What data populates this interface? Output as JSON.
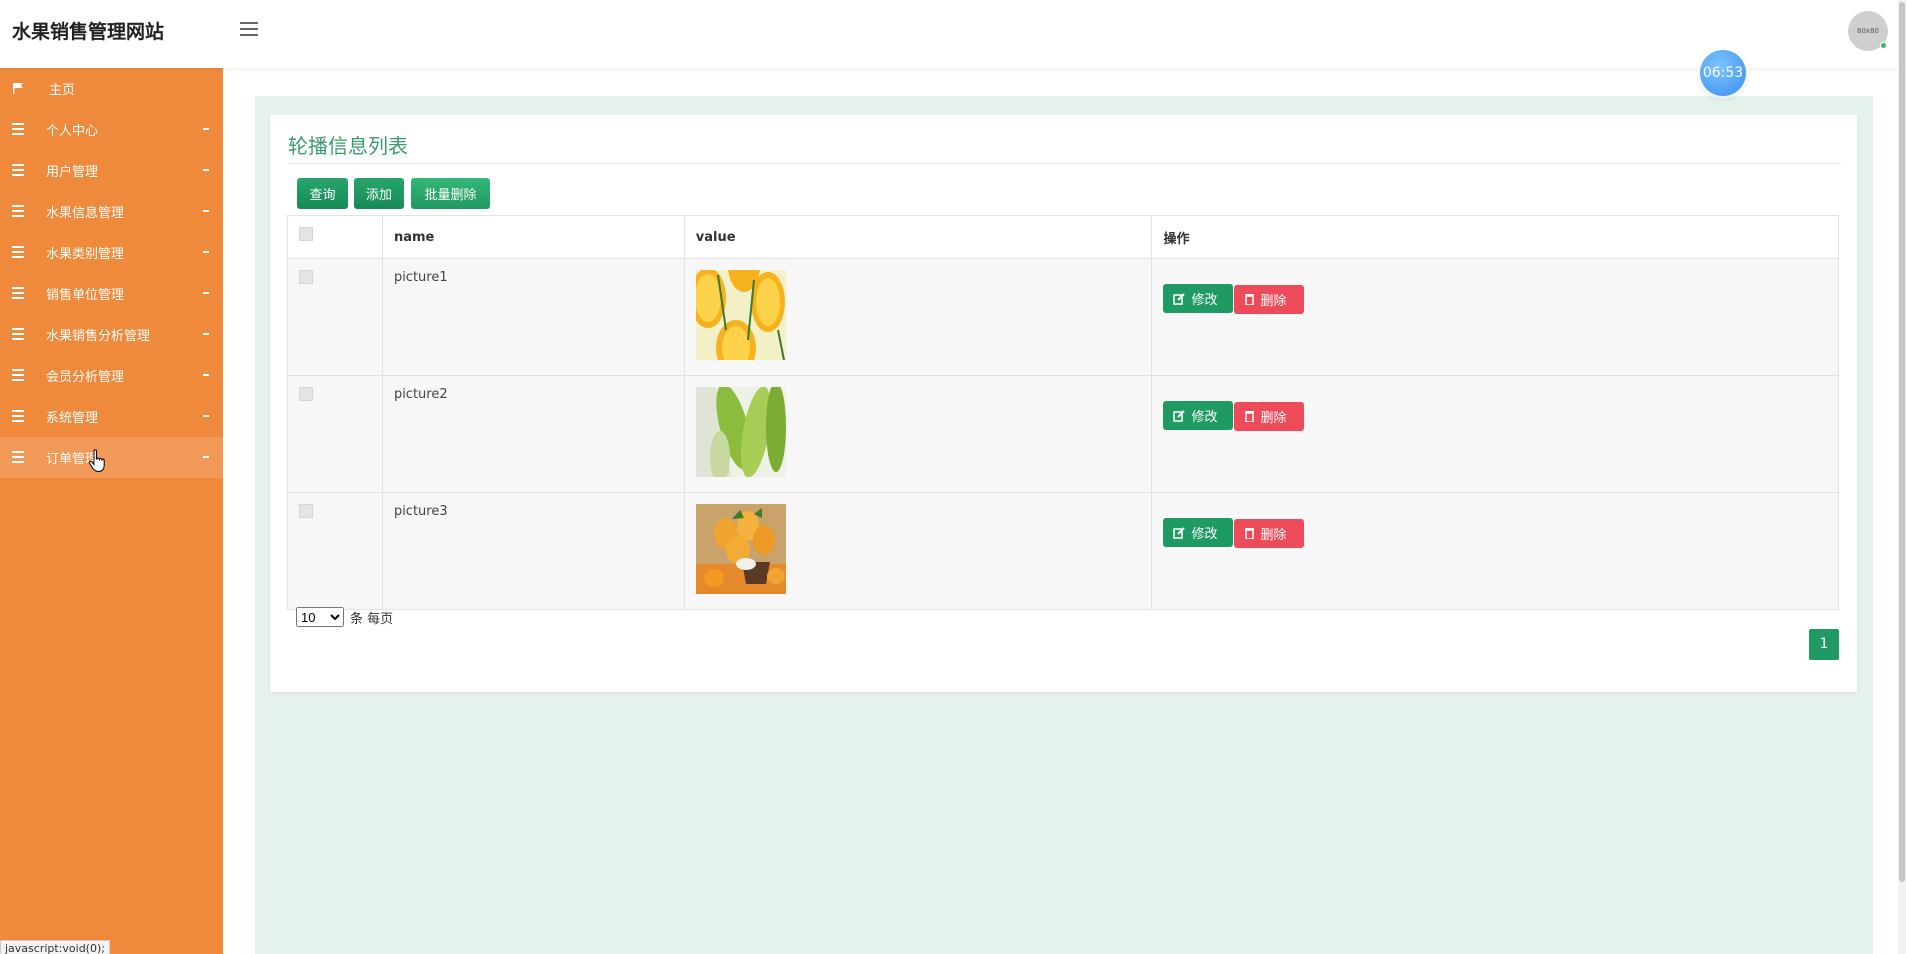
{
  "header": {
    "brand": "水果销售管理网站",
    "avatar_text": "80x80",
    "clock": "06:53"
  },
  "sidebar": {
    "items": [
      {
        "label": "主页",
        "icon": "flag-icon"
      },
      {
        "label": "个人中心",
        "icon": "menu-icon"
      },
      {
        "label": "用户管理",
        "icon": "menu-icon"
      },
      {
        "label": "水果信息管理",
        "icon": "menu-icon"
      },
      {
        "label": "水果类别管理",
        "icon": "menu-icon"
      },
      {
        "label": "销售单位管理",
        "icon": "menu-icon"
      },
      {
        "label": "水果销售分析管理",
        "icon": "menu-icon"
      },
      {
        "label": "会员分析管理",
        "icon": "menu-icon"
      },
      {
        "label": "系统管理",
        "icon": "menu-icon"
      },
      {
        "label": "订单管理",
        "icon": "menu-icon"
      }
    ]
  },
  "status_url": "javascript:void(0);",
  "panel": {
    "title": "轮播信息列表",
    "buttons": {
      "query": "查询",
      "add": "添加",
      "batch_delete": "批量删除"
    },
    "table": {
      "headers": {
        "name": "name",
        "value": "value",
        "ops": "操作"
      },
      "rows": [
        {
          "name": "picture1",
          "image": "orange-slices"
        },
        {
          "name": "picture2",
          "image": "green-mango"
        },
        {
          "name": "picture3",
          "image": "mango-basket"
        }
      ],
      "edit_label": "修改",
      "delete_label": "删除"
    },
    "pagination": {
      "page_size": "10",
      "page_size_suffix": "条 每页",
      "current_page": "1"
    }
  },
  "colors": {
    "sidebar": "#ef8a3c",
    "primary": "#1e9a62",
    "danger": "#ee4b5a",
    "title": "#3c9b6b",
    "content_bg": "#e6f3ec"
  }
}
